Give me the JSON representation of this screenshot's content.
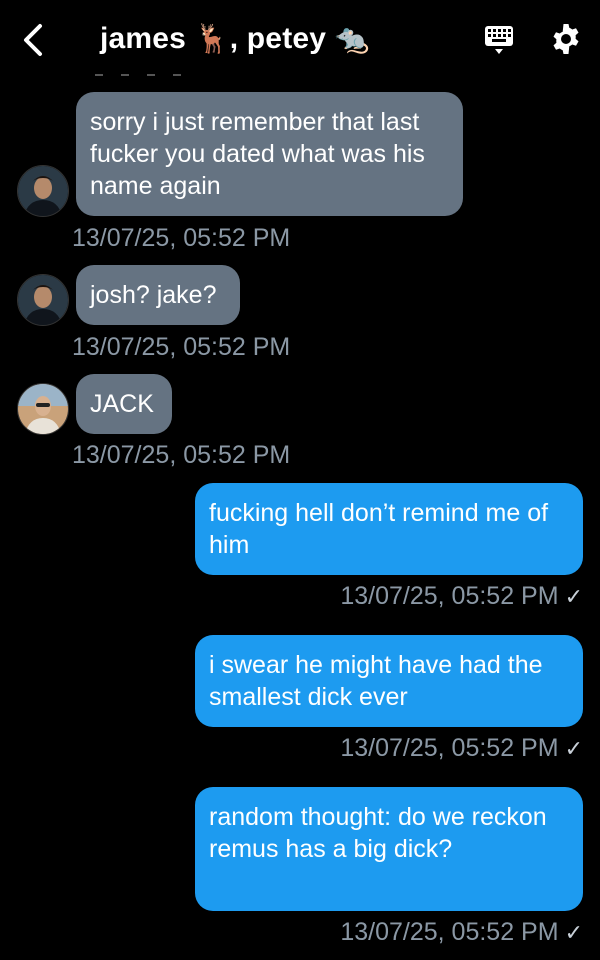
{
  "header": {
    "title_name1": "james",
    "title_emoji1": "🦌",
    "title_sep": ", ",
    "title_name2": "petey",
    "title_emoji2": "🐀",
    "icons": [
      "back-chevron-icon",
      "keyboard-icon",
      "gear-icon"
    ]
  },
  "colors": {
    "incoming": "#657382",
    "outgoing": "#1d9bf0",
    "timestamp": "#8b98a5",
    "background": "#000000"
  },
  "messages": [
    {
      "sender": "other",
      "text": "sorry i just remember that last fucker you dated what was his name again",
      "timestamp": "13/07/25, 05:52 PM"
    },
    {
      "sender": "other",
      "text": "josh? jake?",
      "timestamp": "13/07/25, 05:52 PM"
    },
    {
      "sender": "other",
      "text": "JACK",
      "timestamp": "13/07/25, 05:52 PM"
    },
    {
      "sender": "me",
      "text": "fucking hell don’t remind me of him",
      "timestamp": "13/07/25, 05:52 PM",
      "status": "✓"
    },
    {
      "sender": "me",
      "text": "i swear he might have had the smallest dick ever",
      "timestamp": "13/07/25, 05:52 PM",
      "status": "✓"
    },
    {
      "sender": "me",
      "text": "random thought: do we reckon remus has a big dick?",
      "timestamp": "13/07/25, 05:52 PM",
      "status": "✓"
    }
  ]
}
